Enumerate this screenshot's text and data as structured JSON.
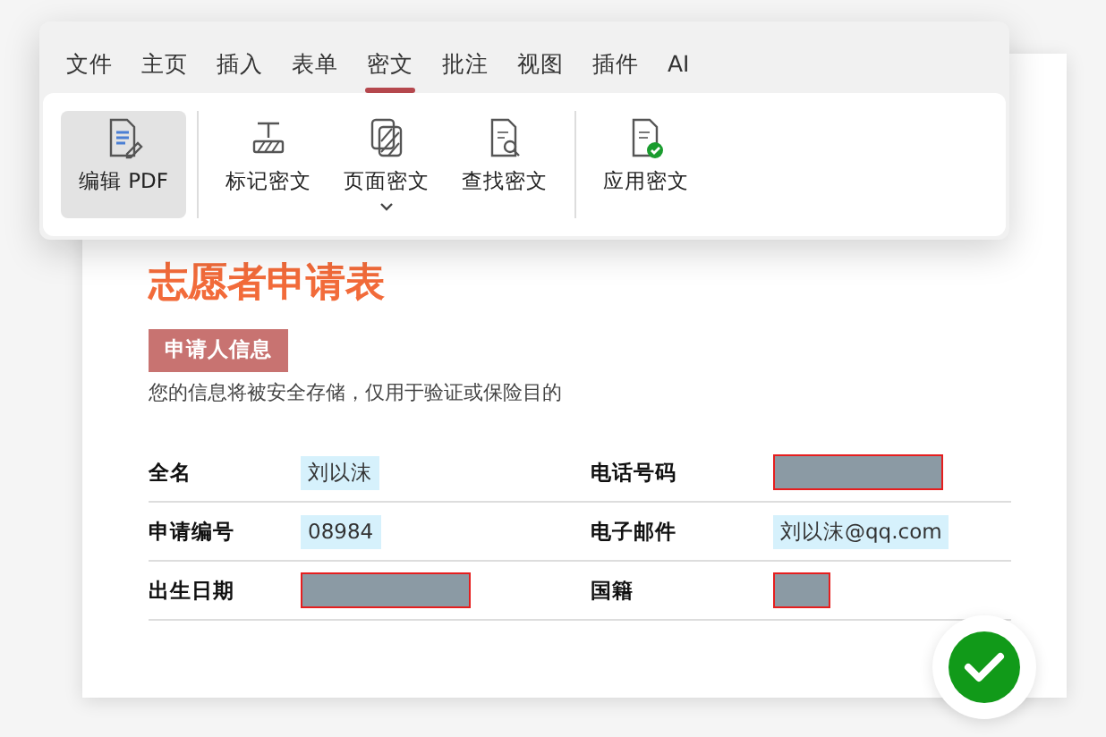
{
  "menu_tabs": [
    {
      "label": "文件",
      "selected": false
    },
    {
      "label": "主页",
      "selected": false
    },
    {
      "label": "插入",
      "selected": false
    },
    {
      "label": "表单",
      "selected": false
    },
    {
      "label": "密文",
      "selected": true
    },
    {
      "label": "批注",
      "selected": false
    },
    {
      "label": "视图",
      "selected": false
    },
    {
      "label": "插件",
      "selected": false
    },
    {
      "label": "AI",
      "selected": false
    }
  ],
  "ribbon_groups": [
    [
      {
        "label": "编辑 PDF",
        "kind": "button",
        "selected": true
      }
    ],
    [
      {
        "label": "标记密文",
        "kind": "button",
        "selected": false
      },
      {
        "label": "页面密文",
        "kind": "dropdown",
        "selected": false
      },
      {
        "label": "查找密文",
        "kind": "button",
        "selected": false
      }
    ],
    [
      {
        "label": "应用密文",
        "kind": "button",
        "selected": false
      }
    ]
  ],
  "document": {
    "title": "志愿者申请表",
    "section_tag": "申请人信息",
    "note": "您的信息将被安全存储，仅用于验证或保险目的",
    "rows": [
      [
        {
          "label": "全名",
          "value": {
            "kind": "highlighted",
            "text": "刘以沫"
          }
        },
        {
          "label": "电话号码",
          "value": {
            "kind": "redacted"
          }
        }
      ],
      [
        {
          "label": "申请编号",
          "value": {
            "kind": "highlighted",
            "text": "08984"
          }
        },
        {
          "label": "电子邮件",
          "value": {
            "kind": "highlighted",
            "text": "刘以沫@qq.com"
          }
        }
      ],
      [
        {
          "label": "出生日期",
          "value": {
            "kind": "redacted"
          }
        },
        {
          "label": "国籍",
          "value": {
            "kind": "redactedshort"
          }
        }
      ]
    ]
  },
  "status_badge": {
    "kind": "success"
  }
}
